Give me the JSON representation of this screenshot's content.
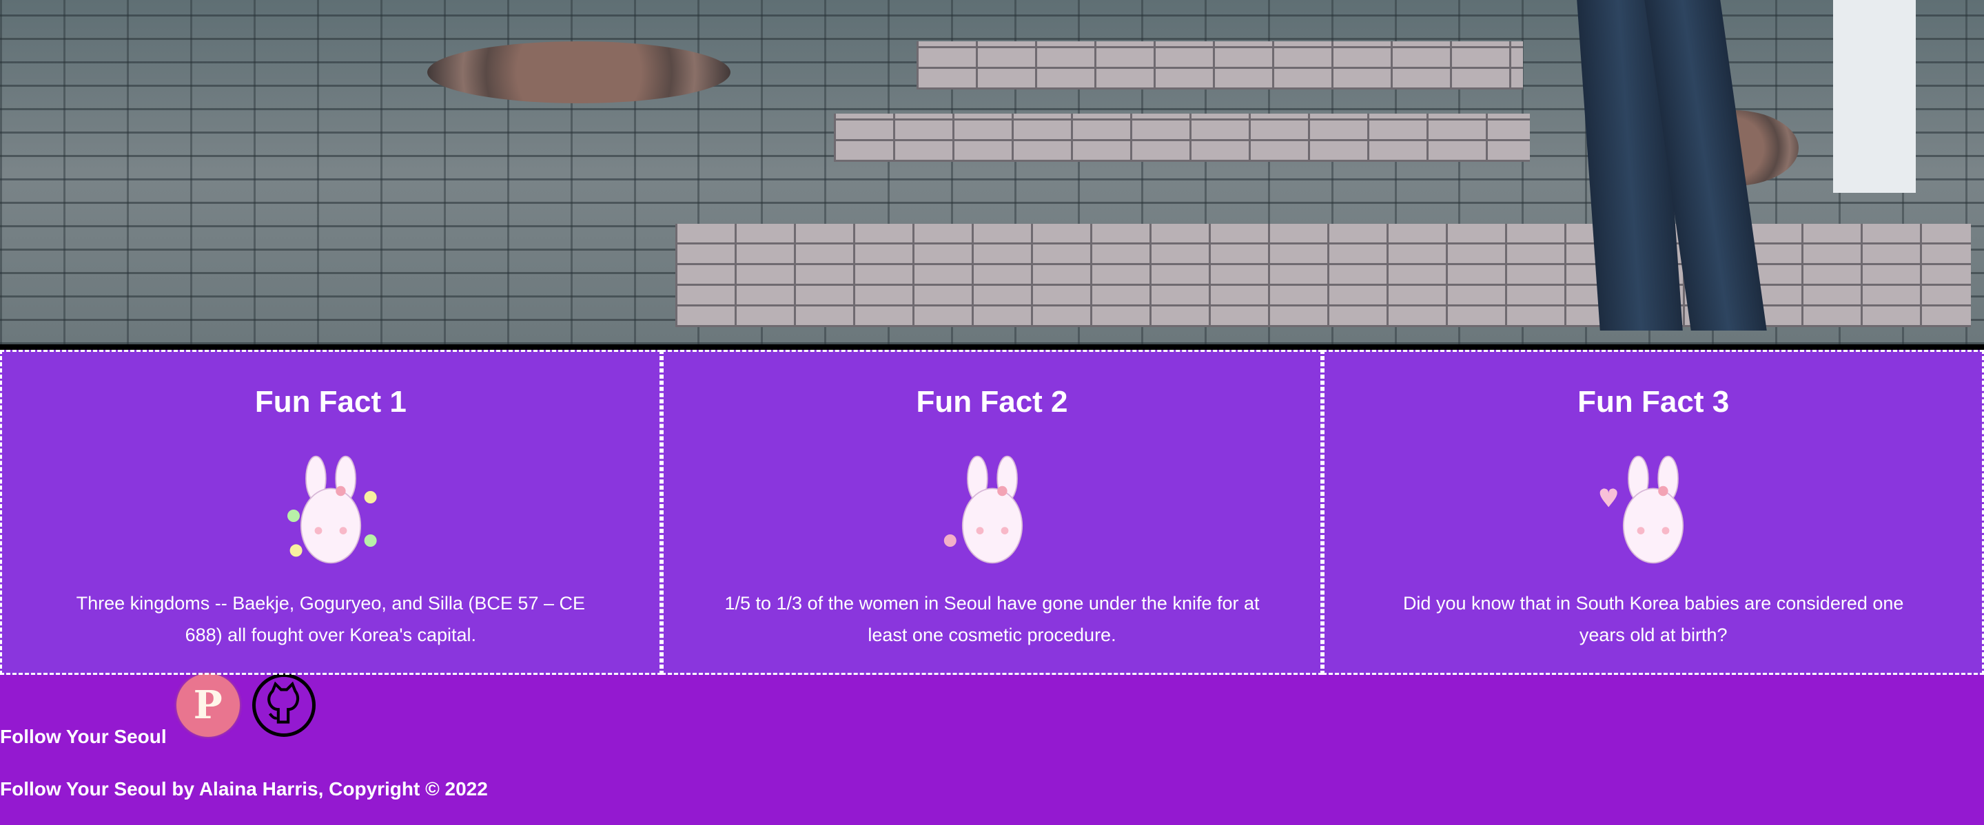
{
  "hero": {
    "image": "seoul-street-pavement-photo"
  },
  "facts": [
    {
      "title": "Fun Fact 1",
      "text": "Three kingdoms -- Baekje, Goguryeo, and Silla (BCE 57 – CE 688) all fought over Korea's capital."
    },
    {
      "title": "Fun Fact 2",
      "text": "1/5 to 1/3 of the women in Seoul have gone under the knife for at least one cosmetic procedure."
    },
    {
      "title": "Fun Fact 3",
      "text": "Did you know that in South Korea babies are considered one years old at birth?"
    }
  ],
  "footer": {
    "follow_label": "Follow Your Seoul",
    "copyright": "Follow Your Seoul by Alaina Harris, Copyright © 2022",
    "icons": [
      "pinterest-icon",
      "github-icon"
    ]
  },
  "colors": {
    "card_bg": "#8a36dd",
    "footer_bg": "#9419d0",
    "pinterest": "#e9758f"
  }
}
